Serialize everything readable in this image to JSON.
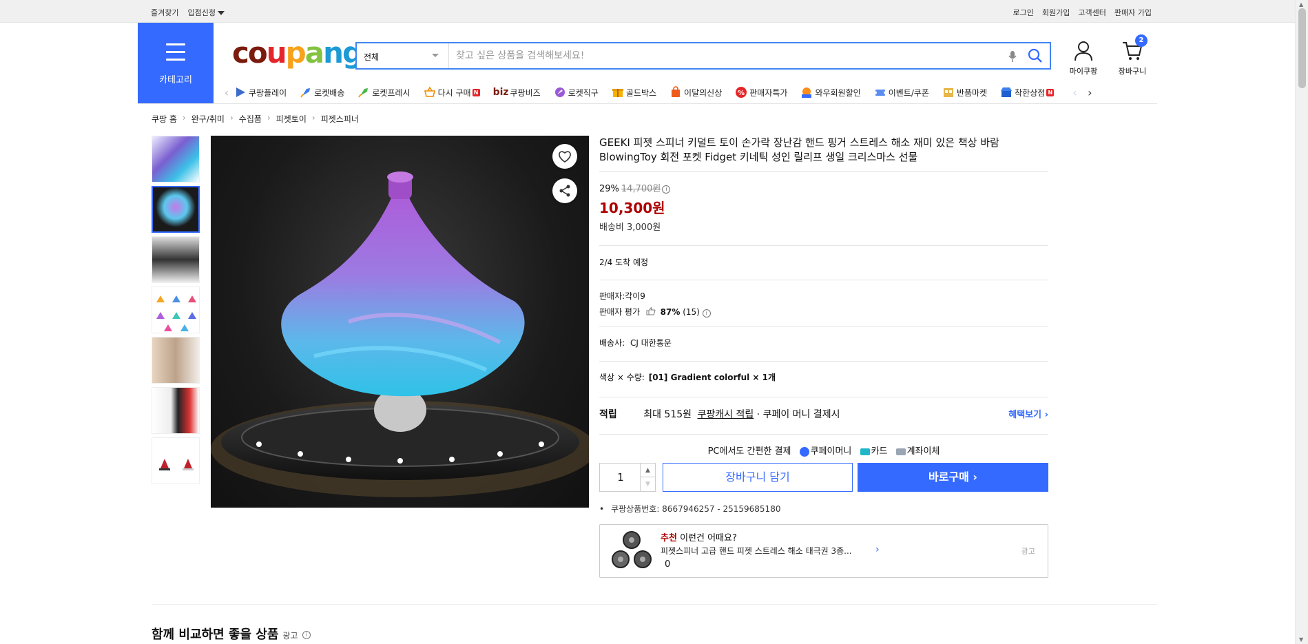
{
  "topbar": {
    "bookmark": "즐겨찾기",
    "apply": "입점신청",
    "login": "로그인",
    "signup": "회원가입",
    "support": "고객센터",
    "seller_signup": "판매자 가입"
  },
  "header": {
    "category_label": "카테고리",
    "logo": [
      "c",
      "o",
      "u",
      "p",
      "a",
      "n",
      "g"
    ],
    "search_category": "전체",
    "search_placeholder": "찾고 싶은 상품을 검색해보세요!",
    "my_coupang": "마이쿠팡",
    "cart": "장바구니",
    "cart_count": "2",
    "accent_color": "#346aff"
  },
  "nav": {
    "items": [
      {
        "label": "쿠팡플레이",
        "icon": "play-icon"
      },
      {
        "label": "로켓배송",
        "icon": "rocket-icon"
      },
      {
        "label": "로켓프레시",
        "icon": "rocket-fresh-icon"
      },
      {
        "label": "다시 구매",
        "icon": "basket-icon",
        "badge": "N"
      },
      {
        "label": "쿠팡비즈",
        "icon": "biz-icon",
        "prefix": "biz"
      },
      {
        "label": "로켓직구",
        "icon": "globe-rocket-icon"
      },
      {
        "label": "골드박스",
        "icon": "gift-box-icon"
      },
      {
        "label": "이달의신상",
        "icon": "shopping-bag-icon"
      },
      {
        "label": "판매자특가",
        "icon": "percent-icon"
      },
      {
        "label": "와우회원할인",
        "icon": "wow-icon"
      },
      {
        "label": "이벤트/쿠폰",
        "icon": "coupon-icon"
      },
      {
        "label": "반품마켓",
        "icon": "market-icon"
      },
      {
        "label": "착한상점",
        "icon": "store-icon",
        "badge": "N"
      }
    ]
  },
  "breadcrumb": [
    "쿠팡 홈",
    "완구/취미",
    "수집품",
    "피젯토이",
    "피젯스피너"
  ],
  "product": {
    "title": "GEEKI 피젯 스피너 키덜트 토이 손가락 장난감 핸드 핑거 스트레스 해소 재미 있은 책상 바람 BlowingToy 회전 포켓 Fidget 키네틱 성인 릴리프 생일 크리스마스 선물",
    "discount": "29%",
    "original_price": "14,700원",
    "sale_price": "10,300원",
    "shipping_fee": "배송비 3,000원",
    "arrival": "2/4 도착 예정",
    "seller_label": "판매자:",
    "seller": "각이9",
    "seller_rating_label": "판매자 평가",
    "seller_rating": "87%",
    "seller_rating_count": "(15)",
    "courier_label": "배송사:",
    "courier": "CJ 대한통운",
    "option_label": "색상 × 수량:",
    "option_value": "[01] Gradient colorful × 1개",
    "reward_label": "적립",
    "reward_max": "최대 515원",
    "reward_link": "쿠팡캐시 적립",
    "reward_suffix": "· 쿠페이 머니 결제시",
    "benefit": "혜택보기",
    "pay_title": "PC에서도 간편한 결제",
    "pay_methods": [
      "쿠페이머니",
      "카드",
      "계좌이체"
    ],
    "quantity": "1",
    "add_to_cart": "장바구니 담기",
    "buy_now": "바로구매",
    "product_no": "쿠팡상품번호: 8667946257 - 25159685180",
    "sale_color": "#ae0000"
  },
  "recommend": {
    "label_red": "추천",
    "label": "이런건 어때요?",
    "name": "피젯스피너 고급 핸드 피젯 스트레스 해소 태극권 3종...",
    "count": "0",
    "ad": "광고"
  },
  "compare": {
    "title": "함께 비교하면 좋을 상품",
    "ad": "광고"
  }
}
